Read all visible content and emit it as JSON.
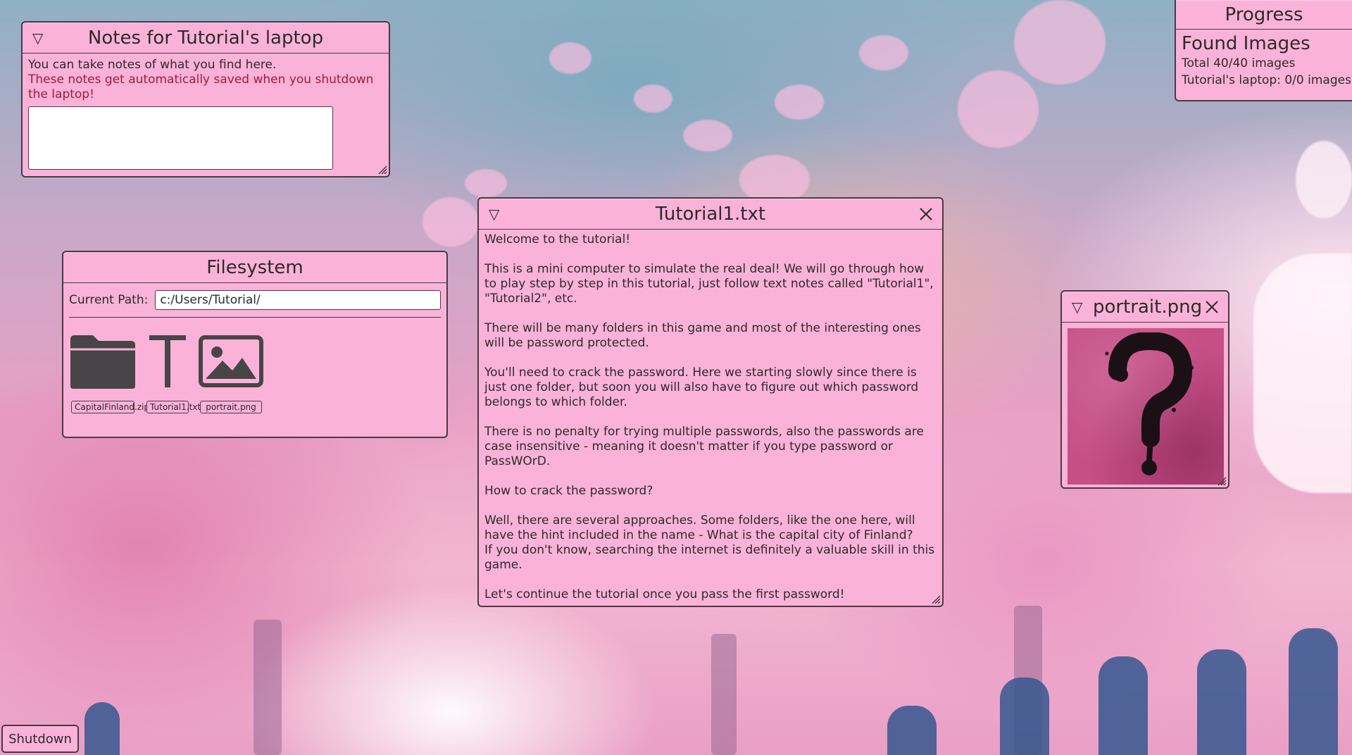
{
  "notes": {
    "title": "Notes for Tutorial's laptop",
    "line1": "You can take notes of what you find here.",
    "line2": "These notes get automatically saved when you shutdown the laptop!",
    "value": ""
  },
  "filesystem": {
    "title": "Filesystem",
    "path_label": "Current Path:",
    "path_value": "c:/Users/Tutorial/",
    "files": [
      {
        "name": "CapitalFinland.zip",
        "icon": "folder-icon"
      },
      {
        "name": "Tutorial1.txt",
        "icon": "text-file-icon"
      },
      {
        "name": "portrait.png",
        "icon": "image-file-icon"
      }
    ]
  },
  "tutorial": {
    "title": "Tutorial1.txt",
    "paragraphs": [
      "Welcome to the tutorial!",
      "This is a mini computer to simulate the real deal! We will go through how to play step by step in this tutorial, just follow text notes called \"Tutorial1\", \"Tutorial2\", etc.",
      "There will be many folders in this game and most of the interesting ones will be password protected.",
      "You'll need to crack the password. Here we starting slowly since there is just one folder, but soon you will also have to figure out which password belongs to which folder.",
      "There is no penalty for trying multiple passwords, also the passwords are case insensitive - meaning it doesn't matter if you type password or PassWOrD.",
      "How to crack the password?",
      "Well, there are several approaches. Some folders, like the one here, will have the hint included in the name - What is the capital city of Finland?\nIf you don't know, searching the internet is definitely a valuable skill in this game.",
      "Let's continue the tutorial once you pass the first password!"
    ]
  },
  "portrait": {
    "title": "portrait.png",
    "image": "question-mark-ink-painting"
  },
  "progress": {
    "title": "Progress",
    "subtitle": "Found Images",
    "total": "Total 40/40 images",
    "laptop": "Tutorial's laptop: 0/0 images"
  },
  "shutdown_label": "Shutdown",
  "colors": {
    "window_bg": "#fbb2d8",
    "border": "#4a3a44",
    "warning_text": "#a01c33"
  }
}
